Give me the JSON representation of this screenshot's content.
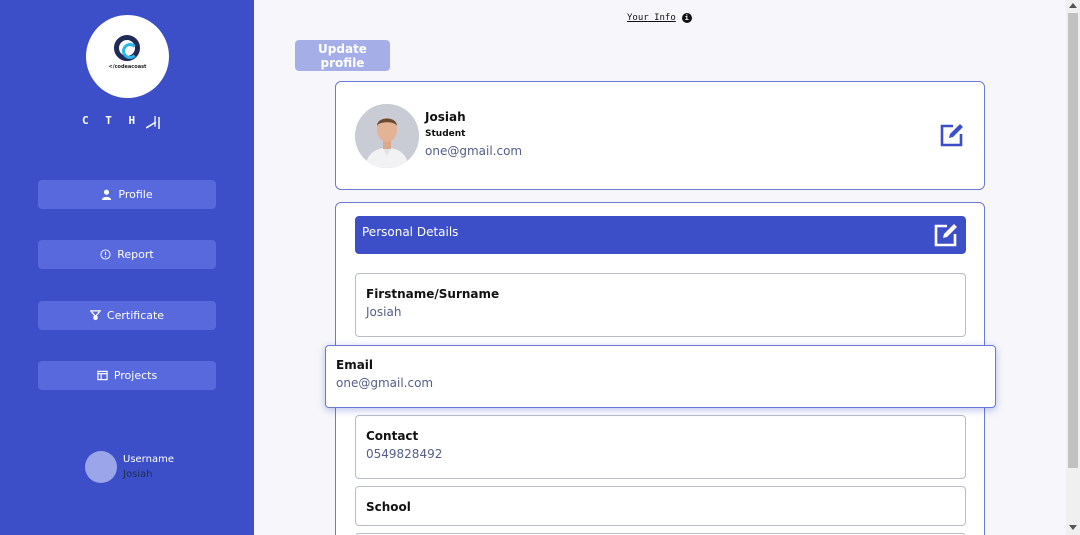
{
  "sidebar": {
    "logo_text": "</codeacoast",
    "brand": "C T H |",
    "nav": [
      {
        "label": "Profile",
        "icon": "user-icon"
      },
      {
        "label": "Report",
        "icon": "info-circle-icon"
      },
      {
        "label": "Certificate",
        "icon": "certificate-icon"
      },
      {
        "label": "Projects",
        "icon": "projects-icon"
      }
    ],
    "user": {
      "label": "Username",
      "name": "Josiah"
    }
  },
  "header": {
    "your_info": "Your Info"
  },
  "update_button": "Update profile",
  "profile": {
    "name": "Josiah",
    "role": "Student",
    "email": "one@gmail.com"
  },
  "details": {
    "title": "Personal Details",
    "fields": [
      {
        "label": "Firstname/Surname",
        "value": "Josiah"
      },
      {
        "label": "Email",
        "value": "one@gmail.com"
      },
      {
        "label": "Contact",
        "value": "0549828492"
      },
      {
        "label": "School",
        "value": ""
      }
    ]
  },
  "colors": {
    "accent": "#3d4fc8",
    "nav_button": "#5868dd",
    "update_button": "#a6aee8"
  }
}
